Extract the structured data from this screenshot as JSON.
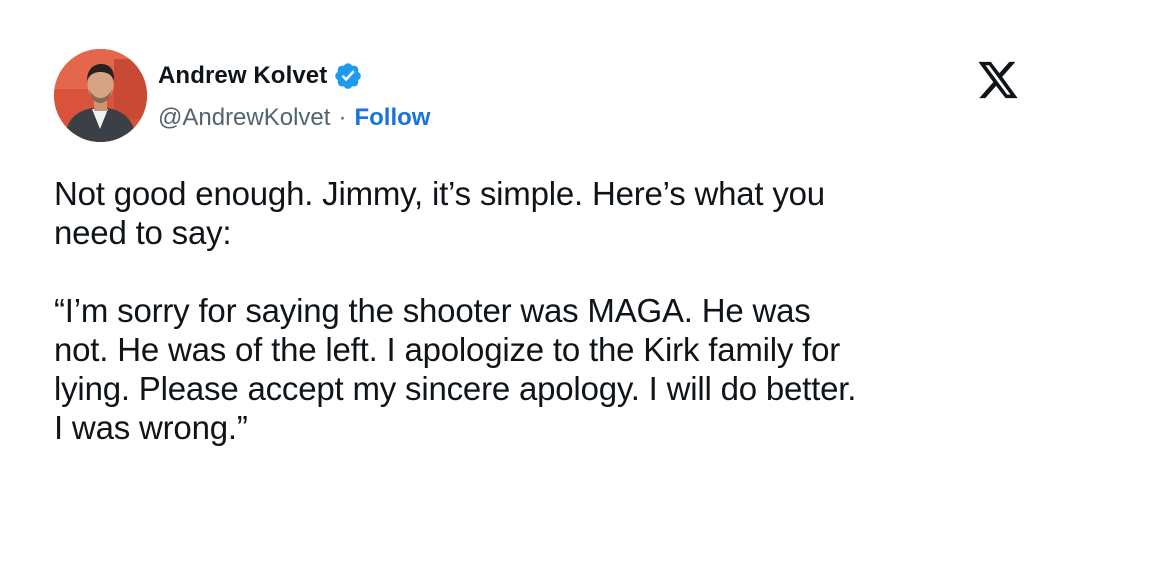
{
  "author": {
    "display_name": "Andrew Kolvet",
    "handle": "@AndrewKolvet",
    "separator": "·",
    "follow_label": "Follow",
    "verified": true,
    "verified_icon": "verified-badge-icon",
    "avatar": "profile-photo"
  },
  "platform": {
    "logo": "x-logo-icon"
  },
  "tweet": {
    "paragraph_1": "Not good enough. Jimmy, it’s simple. Here’s what you\nneed to say:",
    "paragraph_2": "“I’m sorry for saying the shooter was MAGA. He was\nnot. He was of the left. I apologize to the Kirk family for\nlying. Please accept my sincere apology. I will do better.\nI was wrong.”"
  },
  "colors": {
    "text": "#0f1419",
    "muted": "#536471",
    "link": "#1a73d9",
    "verified": "#1d9bf0",
    "avatar_bg": "#d9533c"
  }
}
